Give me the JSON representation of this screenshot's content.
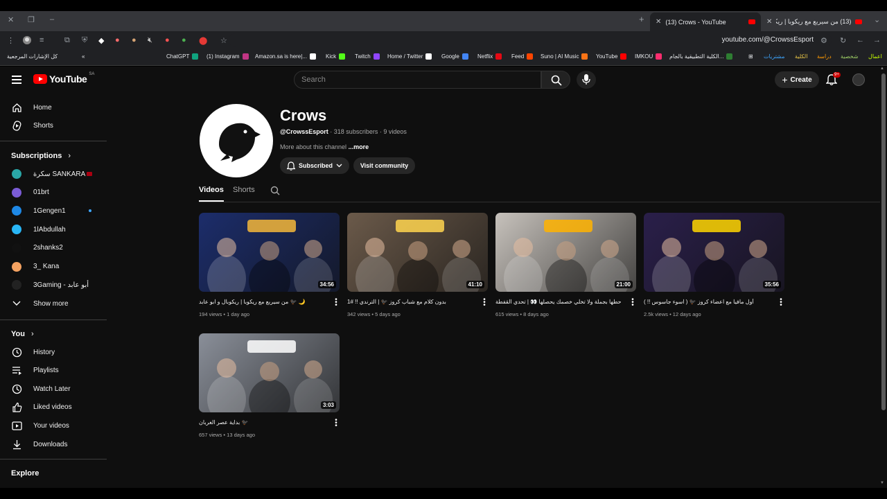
{
  "browser": {
    "tabs": [
      {
        "title": "(13) Crows - YouTube",
        "active": true
      },
      {
        "title": "(13) من سيربع مع ريكوبا | ريكوبا",
        "active": false
      }
    ],
    "url": "youtube.com/@CrowssEsport",
    "bookmarks": [
      {
        "label": "كل الإشارات المرجعية",
        "color": "#9aa0a6"
      },
      {
        "label": "ChatGPT",
        "color": "#10a37f"
      },
      {
        "label": "(1) Instagram",
        "color": "#c13584"
      },
      {
        "label": "Amazon.sa is here|...",
        "color": "#ffffff"
      },
      {
        "label": "Kick",
        "color": "#53fc18"
      },
      {
        "label": "Twitch",
        "color": "#9146ff"
      },
      {
        "label": "Home / Twitter",
        "color": "#ffffff"
      },
      {
        "label": "Google",
        "color": "#4285f4"
      },
      {
        "label": "Netflix",
        "color": "#e50914"
      },
      {
        "label": "Feed",
        "color": "#ff4500"
      },
      {
        "label": "Suno | AI Music",
        "color": "#f97316"
      },
      {
        "label": "YouTube",
        "color": "#ff0000"
      },
      {
        "label": "IMKOU",
        "color": "#ff2d6f"
      },
      {
        "label": "الكلية التطبيقية بالجام...",
        "color": "#2e7d32"
      },
      {
        "label": "مشتريات",
        "color": "#3ea6ff"
      },
      {
        "label": "الكلية",
        "color": "#e8c547"
      },
      {
        "label": "دراسة",
        "color": "#ff9800"
      },
      {
        "label": "شخصية",
        "color": "#9ccc65"
      },
      {
        "label": "اعمال",
        "color": "#c6ff00"
      }
    ]
  },
  "youtube": {
    "logo_text": "YouTube",
    "country_code": "SA",
    "search_placeholder": "Search",
    "create_label": "Create",
    "notif_badge": "9+",
    "sidebar": {
      "main": [
        {
          "label": "Home",
          "icon": "home-icon"
        },
        {
          "label": "Shorts",
          "icon": "shorts-icon"
        }
      ],
      "subscriptions_title": "Subscriptions",
      "subscriptions": [
        {
          "label": "سكرة SANKARA",
          "color": "#2aa6a6",
          "live": "red"
        },
        {
          "label": "01brt",
          "color": "#7b5cd6",
          "live": ""
        },
        {
          "label": "1Gengen1",
          "color": "#1e88e5",
          "live": "blue"
        },
        {
          "label": "1lAbdullah",
          "color": "#29b6f6",
          "live": ""
        },
        {
          "label": "2shanks2",
          "color": "#111111",
          "live": ""
        },
        {
          "label": "3_ Kana",
          "color": "#f4a261",
          "live": ""
        },
        {
          "label": "3Gaming - أبو عابد",
          "color": "#222222",
          "live": ""
        }
      ],
      "show_more": "Show more",
      "you_title": "You",
      "you_items": [
        {
          "label": "History",
          "icon": "history-icon"
        },
        {
          "label": "Playlists",
          "icon": "playlists-icon"
        },
        {
          "label": "Watch Later",
          "icon": "watch-later-icon"
        },
        {
          "label": "Liked videos",
          "icon": "like-icon"
        },
        {
          "label": "Your videos",
          "icon": "your-videos-icon"
        },
        {
          "label": "Downloads",
          "icon": "download-icon"
        }
      ],
      "explore_title": "Explore"
    },
    "channel": {
      "name": "Crows",
      "handle": "@CrowssEsport",
      "stats": " · 318 subscribers · 9 videos",
      "about": "More about this channel ",
      "more": "...more",
      "subscribed_label": "Subscribed",
      "visit_label": "Visit community",
      "tabs": [
        "Videos",
        "Shorts"
      ]
    },
    "videos": [
      {
        "title": "من سيربع مع ريكوبا | ريكوبال و ابو عابد 🐦‍⬛ 🌙",
        "meta": "194 views • 1 day ago",
        "duration": "34:56",
        "bg": "#1c2d6b",
        "accent": "#f4b73a"
      },
      {
        "title": "بدون كلام مع شباب كروز 🐦‍⬛ | الترندي !! #1",
        "meta": "342 views • 5 days ago",
        "duration": "41:10",
        "bg": "#6b5a4a",
        "accent": "#ffd54f"
      },
      {
        "title": "حطها بجملة ولا تخلي خصمك يحصلها 👀 | تحدي القفطة",
        "meta": "615 views • 8 days ago",
        "duration": "21:00",
        "bg": "#c7c2bc",
        "accent": "#ffb300"
      },
      {
        "title": "أول مافيا مع اعضاء كروز 🐦‍⬛ ( اسوء جاسوس !! )",
        "meta": "2.5k views • 12 days ago",
        "duration": "35:56",
        "bg": "#2a1f4a",
        "accent": "#ffd600"
      },
      {
        "title": "بداية عصر الغربان 🐦‍⬛",
        "meta": "657 views • 13 days ago",
        "duration": "3:03",
        "bg": "#8a8f99",
        "accent": "#ffffff"
      }
    ]
  }
}
